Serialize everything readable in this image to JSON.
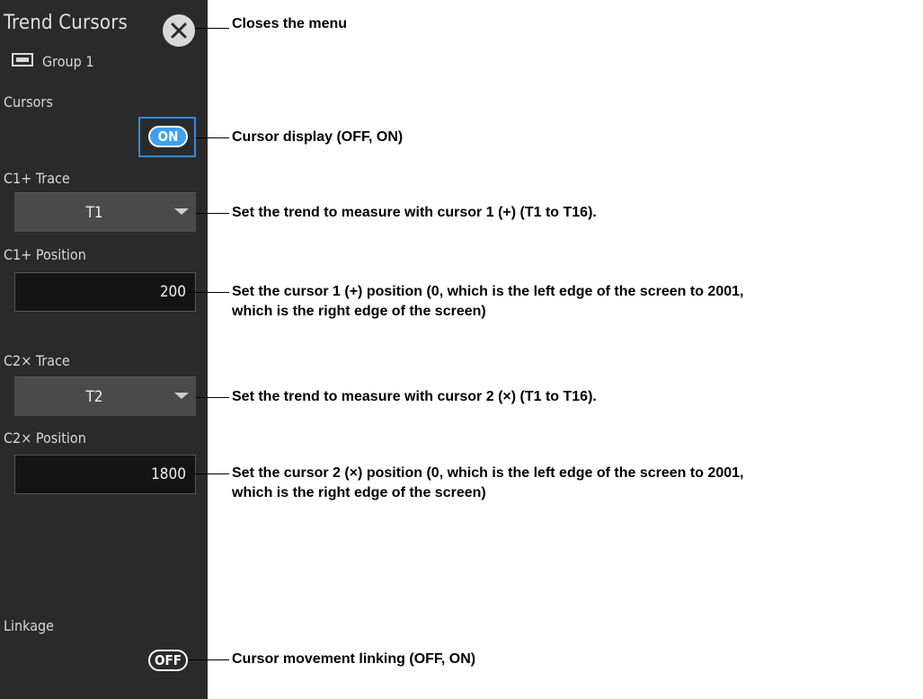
{
  "menu": {
    "title": "Trend Cursors",
    "group_label": "Group 1",
    "cursors_label": "Cursors",
    "cursors_toggle": "ON",
    "c1_trace_label": "C1+ Trace",
    "c1_trace_value": "T1",
    "c1_position_label": "C1+ Position",
    "c1_position_value": "200",
    "c2_trace_label": "C2× Trace",
    "c2_trace_value": "T2",
    "c2_position_label": "C2× Position",
    "c2_position_value": "1800",
    "linkage_label": "Linkage",
    "linkage_toggle": "OFF"
  },
  "annotations": {
    "close": "Closes the menu",
    "cursor_display": "Cursor display (OFF, ON)",
    "c1_trace": "Set the trend to measure with cursor 1 (+) (T1 to T16).",
    "c1_position_line1": "Set the cursor 1 (+) position (0, which is the left edge of the screen to 2001,",
    "c1_position_line2": "which is the right edge of the screen)",
    "c2_trace": "Set the trend to measure with cursor 2 (×) (T1 to T16).",
    "c2_position_line1": "Set the cursor 2 (×) position (0, which is the left edge of the screen to 2001,",
    "c2_position_line2": "which is the right edge of the screen)",
    "linkage": "Cursor movement linking (OFF, ON)"
  },
  "icons": {
    "close": "close-icon",
    "group": "group-display-icon",
    "dropdown": "caret-down-icon"
  },
  "colors": {
    "panel": "#2a2a2a",
    "accent": "#3da0f0",
    "focus": "#2f8be6"
  }
}
